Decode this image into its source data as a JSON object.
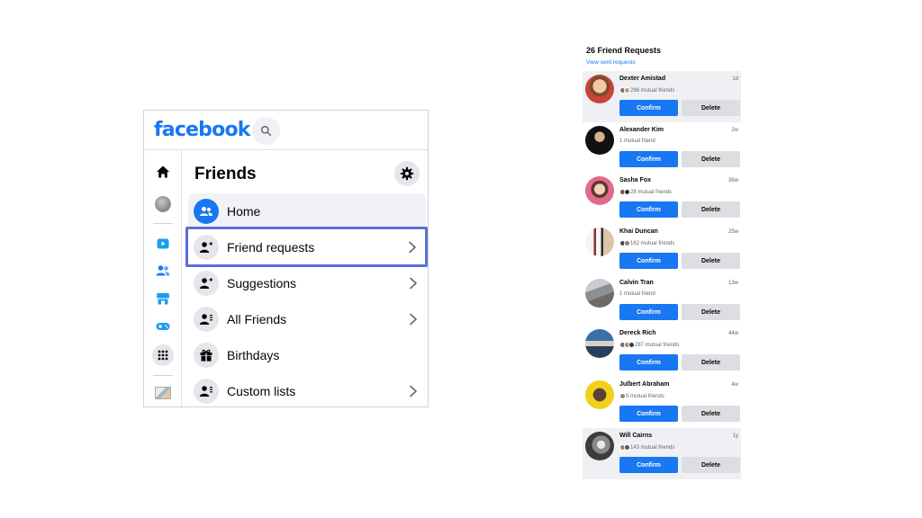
{
  "app": {
    "logo": "facebook",
    "brand_color": "#1877f2"
  },
  "left_panel": {
    "title": "Friends",
    "menu": [
      {
        "label": "Home",
        "icon": "friends-home-icon",
        "has_chevron": false
      },
      {
        "label": "Friend requests",
        "icon": "friend-request-icon",
        "has_chevron": true
      },
      {
        "label": "Suggestions",
        "icon": "friend-suggestion-icon",
        "has_chevron": true
      },
      {
        "label": "All Friends",
        "icon": "all-friends-icon",
        "has_chevron": true
      },
      {
        "label": "Birthdays",
        "icon": "gift-icon",
        "has_chevron": false
      },
      {
        "label": "Custom lists",
        "icon": "custom-list-icon",
        "has_chevron": true
      }
    ],
    "highlight_color": "#5b6fd6"
  },
  "requests": {
    "title": "26 Friend Requests",
    "link": "View sent requests",
    "confirm_label": "Confirm",
    "delete_label": "Delete",
    "items": [
      {
        "name": "Dexter Amistad",
        "time": "1d",
        "mutual": "286 mutual friends"
      },
      {
        "name": "Alexander Kim",
        "time": "2w",
        "mutual": "1 mutual friend"
      },
      {
        "name": "Sasha Fox",
        "time": "36w",
        "mutual": "28 mutual friends"
      },
      {
        "name": "Khai Duncan",
        "time": "25w",
        "mutual": "162 mutual friends"
      },
      {
        "name": "Calvin Tran",
        "time": "13w",
        "mutual": "1 mutual friend"
      },
      {
        "name": "Dereck Rich",
        "time": "44w",
        "mutual": "287 mutual friends"
      },
      {
        "name": "Julbert Abraham",
        "time": "4w",
        "mutual": "5 mutual friends"
      },
      {
        "name": "Will Cairns",
        "time": "1y",
        "mutual": "143 mutual friends"
      }
    ]
  }
}
